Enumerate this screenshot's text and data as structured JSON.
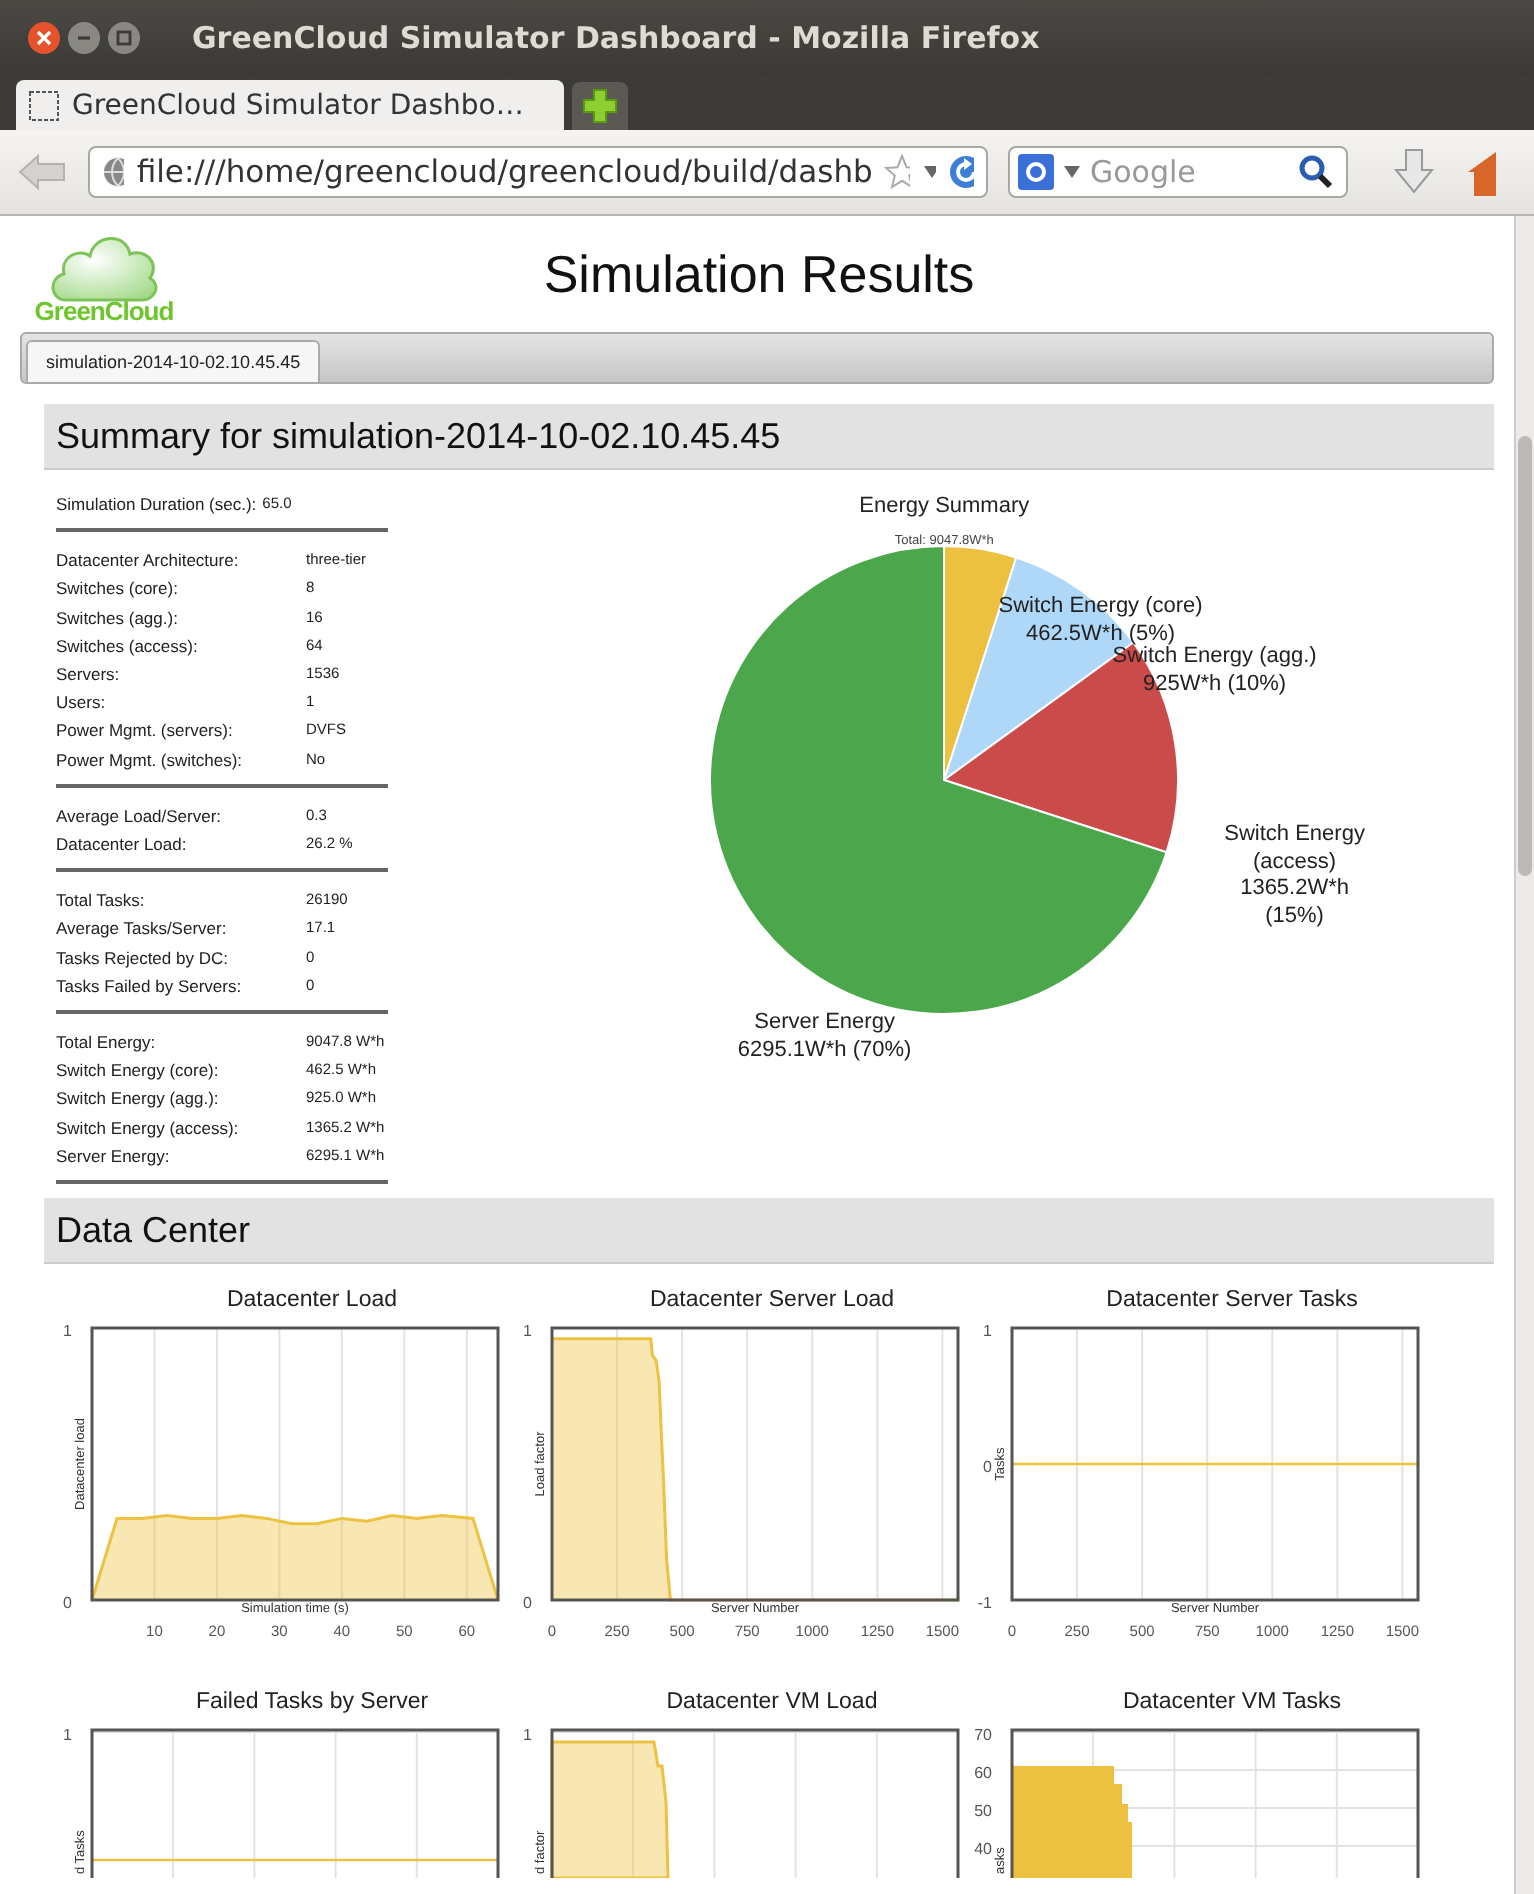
{
  "window": {
    "title": "GreenCloud Simulator Dashboard - Mozilla Firefox"
  },
  "browser_tabs": [
    {
      "label": "GreenCloud Simulator Dashbo…",
      "selected": true
    }
  ],
  "address_bar": {
    "value": "file:///home/greencloud/greencloud/build/dashb"
  },
  "search": {
    "placeholder": "Google"
  },
  "page": {
    "logo": "GreenCloud",
    "title": "Simulation Results"
  },
  "sim_tabs": [
    {
      "label": "simulation-2014-10-02.10.45.45",
      "selected": true
    }
  ],
  "summary": {
    "heading": "Summary for simulation-2014-10-02.10.45.45",
    "stat_groups": [
      {
        "kind": "inline",
        "rows": [
          {
            "label": "Simulation Duration (sec.):",
            "value": "65.0"
          }
        ]
      },
      {
        "kind": "table",
        "rows": [
          {
            "label": "Datacenter Architecture:",
            "value": "three-tier"
          },
          {
            "label": "Switches (core):",
            "value": "8"
          },
          {
            "label": "Switches (agg.):",
            "value": "16"
          },
          {
            "label": "Switches (access):",
            "value": "64"
          },
          {
            "label": "Servers:",
            "value": "1536"
          },
          {
            "label": "Users:",
            "value": "1"
          },
          {
            "label": "Power Mgmt. (servers):",
            "value": "DVFS"
          },
          {
            "label": "Power Mgmt. (switches):",
            "value": "No"
          }
        ]
      },
      {
        "kind": "table",
        "rows": [
          {
            "label": "Average Load/Server:",
            "value": "0.3"
          },
          {
            "label": "Datacenter Load:",
            "value": "26.2 %"
          }
        ]
      },
      {
        "kind": "table",
        "rows": [
          {
            "label": "Total Tasks:",
            "value": "26190"
          },
          {
            "label": "Average Tasks/Server:",
            "value": "17.1"
          },
          {
            "label": "Tasks Rejected by DC:",
            "value": "0"
          },
          {
            "label": "Tasks Failed by Servers:",
            "value": "0"
          }
        ]
      },
      {
        "kind": "table",
        "rows": [
          {
            "label": "Total Energy:",
            "value": "9047.8 W*h"
          },
          {
            "label": "Switch Energy (core):",
            "value": "462.5 W*h"
          },
          {
            "label": "Switch Energy (agg.):",
            "value": "925.0 W*h"
          },
          {
            "label": "Switch Energy (access):",
            "value": "1365.2 W*h"
          },
          {
            "label": "Server Energy:",
            "value": "6295.1 W*h"
          }
        ]
      }
    ],
    "energy_chart": {
      "subtitle": "Total: 9047.8W*h",
      "chart_data": {
        "type": "pie",
        "title": "Energy Summary",
        "categories": [
          "Switch Energy (core)",
          "Switch Energy (agg.)",
          "Switch Energy (access)",
          "Server Energy"
        ],
        "values": [
          5,
          10,
          15,
          70
        ],
        "colors": [
          "#ecc13f",
          "#afd8f8",
          "#cb4b4b",
          "#4ca74c"
        ],
        "value_labels": [
          "462.5W*h (5%)",
          "925W*h (10%)",
          "1365.2W*h (15%)",
          "6295.1W*h (70%)"
        ]
      }
    }
  },
  "data_center": {
    "heading": "Data Center",
    "charts": [
      {
        "title": "Datacenter Load",
        "chart_data": {
          "type": "area",
          "grid": true,
          "xlabel": "Simulation time (s)",
          "ylabel": "Datacenter load",
          "xlim": [
            0,
            65
          ],
          "ylim": [
            0,
            1
          ],
          "xticks": [
            10,
            20,
            30,
            40,
            50,
            60
          ],
          "yticks": [
            0,
            1
          ],
          "x": [
            0,
            4,
            8,
            12,
            16,
            20,
            24,
            28,
            32,
            36,
            40,
            44,
            48,
            52,
            56,
            61,
            65
          ],
          "series": [
            {
              "color": "#edc240",
              "values": [
                0,
                0.3,
                0.3,
                0.31,
                0.3,
                0.3,
                0.31,
                0.3,
                0.28,
                0.28,
                0.3,
                0.29,
                0.31,
                0.3,
                0.31,
                0.3,
                0
              ]
            }
          ]
        }
      },
      {
        "title": "Datacenter Server Load",
        "chart_data": {
          "type": "area",
          "grid": true,
          "xlabel": "Server Number",
          "ylabel": "Load factor",
          "xlim": [
            0,
            1560
          ],
          "ylim": [
            0,
            1
          ],
          "xticks": [
            0,
            250,
            500,
            750,
            1000,
            1250,
            1500
          ],
          "yticks": [
            0,
            1
          ],
          "x": [
            0,
            380,
            386,
            400,
            412,
            420,
            428,
            440,
            455,
            1560
          ],
          "series": [
            {
              "color": "#edc240",
              "values": [
                0.96,
                0.96,
                0.9,
                0.88,
                0.8,
                0.6,
                0.45,
                0.15,
                0,
                0
              ]
            }
          ]
        }
      },
      {
        "title": "Datacenter Server Tasks",
        "chart_data": {
          "type": "line",
          "grid": true,
          "xlabel": "Server Number",
          "ylabel": "Tasks",
          "xlim": [
            0,
            1560
          ],
          "ylim": [
            -1,
            1
          ],
          "xticks": [
            0,
            250,
            500,
            750,
            1000,
            1250,
            1500
          ],
          "yticks": [
            -1,
            0,
            1
          ],
          "x": [
            0,
            1560
          ],
          "series": [
            {
              "color": "#edc240",
              "values": [
                0,
                0
              ]
            }
          ]
        }
      },
      {
        "title": "Failed Tasks by Server",
        "kind": "flat-line",
        "ylabel": "d Tasks",
        "y_tick_labels": [
          "1"
        ]
      },
      {
        "title": "Datacenter VM Load",
        "kind": "drop-area",
        "ylabel": "d factor",
        "y_tick_labels": [
          "1"
        ]
      },
      {
        "title": "Datacenter VM Tasks",
        "kind": "steps",
        "ylabel": "asks",
        "y_tick_labels": [
          "70",
          "60",
          "50",
          "40"
        ]
      }
    ]
  }
}
